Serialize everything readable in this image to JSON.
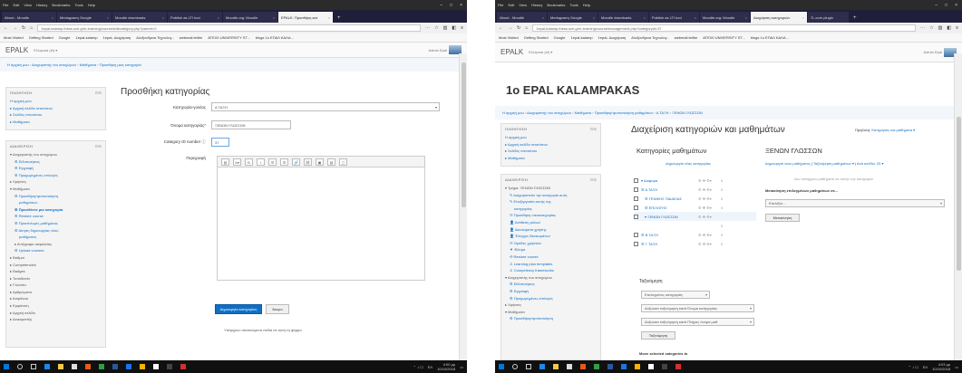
{
  "browser": {
    "menu": [
      "File",
      "Edit",
      "View",
      "History",
      "Bookmarks",
      "Tools",
      "Help"
    ],
    "window_controls": [
      "–",
      "□",
      "×"
    ],
    "bookmarks": [
      "Most Visited",
      "Getting Started",
      "Google",
      "1epal-kalamp",
      "1epal- Διαχείριση",
      "Αλεξανδρεια Τεχνολογ..",
      "webmail.teithe",
      "ATEIXI UNIVERSITY ST...",
      "blogs 1o ΕΠΑΛ ΚΑΛΑ..."
    ],
    "tab_plus": "+"
  },
  "shotA": {
    "tabs": [
      "About - Moodle",
      "Μετάφραση Google",
      "Moodle downloads",
      "Publish as LTI tool",
      "Moodle.org: Moodle",
      "EPALK: Προσθήκη κατ"
    ],
    "url": "1epal-kalamp.thess.sch.gr/e-learning/course/editcategory.php?parent=0",
    "site_brand": "EPALK",
    "lang": "Ελληνικά (el) ▾",
    "user": "Admin Epal",
    "breadcrumb": [
      "Η αρχική μου",
      "Διαχειριστής του ιστοχώρου",
      "Μαθήματα",
      "Προσθήκη μιας κατηγορία"
    ],
    "nav_block": {
      "title": "ΠΛΟΗΓΗΣΗ",
      "items": [
        "Η αρχική μου",
        "▸ Αρχική σελίδα ιστοτόπου",
        "▸ Σελίδες ιστοτόπου",
        "▸ Μαθήματα"
      ]
    },
    "admin_block": {
      "title": "ΔΙΑΧΕΙΡΙΣΗ",
      "items": [
        "▾ Διαχειριστής του ιστοχώρου",
        "⚙ Ειδοποιήσεις",
        "⚙ Εγγραφή",
        "⚙ Προχωρημένες επιλογές",
        "▸ Χρήστες",
        "▾ Μαθήματα",
        "⚙ Προσθήκη/τροποποίηση",
        "μαθημάτων",
        "⚙ Προσθέστε μια κατηγορία",
        "⚙ Restore course",
        "⚙ Προεπιλογές μαθήματος",
        "⚙ Αίτηση δημιουργίας νέου",
        "μαθήματος",
        "▸ Αντίγραφα ασφαλείας",
        "⚙ Upload courses",
        "▸ Βαθμοί",
        "▸ Competencies",
        "▸ Badges",
        "▸ Τοποθεσία",
        "▸ Γλώσσα",
        "▸ Αρθρώματα",
        "▸ Ασφάλεια",
        "▸ Εμφάνιση",
        "▸ Αρχική σελίδα",
        "▸ Διακομιστής"
      ]
    },
    "page_title": "Προσθήκη κατηγορίας",
    "form": {
      "parent_label": "Κατηγορία-γονέας",
      "parent_value": "Α ΤΑΞΗ",
      "name_label": "Όνομα κατηγορίας",
      "name_value": "ΞΕΝΩΝ ΓΛΩΣΣΩΝ",
      "idnumber_label": "Category ID number",
      "idnumber_value": "37",
      "desc_label": "Περιγραφή",
      "create_button": "Δημιουργία κατηγορίας",
      "cancel_button": "Άκυρο",
      "required_note": "Υπάρχουν απαιτούμενα πεδία σε αυτή τη φόρμα"
    },
    "editor_tools": [
      "▤",
      "A▾",
      "B",
      "I",
      "☰",
      "☰",
      "🔗",
      "⛓",
      "▣",
      "▤",
      "▢"
    ],
    "tray": {
      "time": "4:00 μμ",
      "date": "10/10/2018",
      "lang": "ΕΛ"
    }
  },
  "shotB": {
    "tabs": [
      "About - Moodle",
      "Μετάφραση Google",
      "Moodle downloads",
      "Publish as LTI tool",
      "Moodle.org: Moodle",
      "Διαχείριση κατηγοριών",
      "7L.com plugin"
    ],
    "url": "1epal-kalamp.thess.sch.gr/e-learning/course/management.php?categoryid=37",
    "site_brand": "EPALK",
    "lang": "Ελληνικά (el) ▾",
    "user": "Admin Epal",
    "site_heading": "1o EPAL KALAMPAKAS",
    "breadcrumb": [
      "Η αρχική μου",
      "Διαχειριστής του ιστοχώρου",
      "Μαθήματα",
      "Προσθήκη/τροποποίηση μαθημάτων",
      "Α ΤΑΞΗ",
      "ΞΕΝΩΝ ΓΛΩΣΣΩΝ"
    ],
    "nav_block": {
      "title": "ΠΛΟΗΓΗΣΗ",
      "items": [
        "Η αρχική μου",
        "▸ Αρχική σελίδα ιστοτόπου",
        "▸ Σελίδες ιστοτόπου",
        "▸ Μαθήματα"
      ]
    },
    "admin_block": {
      "title": "ΔΙΑΧΕΙΡΙΣΗ",
      "items": [
        "▾ Τμήμα: ΞΕΝΩΝ ΓΛΩΣΣΩΝ",
        "✎ Διαχειριστείτε την κατηγορία αυτή",
        "✎ Επεξεργασία αυτής της",
        "κατηγορίας",
        "☷ Προσθήκη υποκατηγορίας",
        "👤 Ανάθεση ρόλων",
        "👤 Δικαιώματα χρήσης",
        "👤 Έλεγχος δικαιωμάτων",
        "☷ Ομάδες χρηστών",
        "▼ Φίλτρα",
        "⟲ Restore course",
        "♙ Learning plan templates",
        "♙ Competency frameworks",
        "▾ Διαχειριστής του ιστοχώρου",
        "⚙ Ειδοποιήσεις",
        "⚙ Εγγραφή",
        "⚙ Προχωρημένες επιλογές",
        "▸ Χρήστες",
        "▾ Μαθήματα",
        "⚙ Προσθήκη/τροποποίηση"
      ]
    },
    "page_title": "Διαχείριση κατηγοριών και μαθημάτων",
    "view_label": "Προβολή:",
    "view_value": "Κατηγορίες και μαθήματα ▾",
    "cat_heading": "Κατηγορίες μαθημάτων",
    "cat_create": "Δημιουργία νέας κατηγορίας",
    "categories": [
      {
        "name": "▾ Διάφορα",
        "count": "0"
      },
      {
        "name": "☰ Α ΤΑΞΗ",
        "count": "0"
      },
      {
        "name": "☰ ΓΕΝΙΚΗΣ ΠΑΙΔΕΙΑΣ",
        "count": "0"
      },
      {
        "name": "☰ ΕΠΙΛΟΓΗΣ",
        "count": "0"
      },
      {
        "name": "▾ ΞΕΝΩΝ ΓΛΩΣΣΩΝ",
        "count": ""
      },
      {
        "name": "",
        "count": "0"
      },
      {
        "name": "☰ Β ΤΑΞΗ",
        "count": "0"
      },
      {
        "name": "☰ Γ ΤΑΞΗ",
        "count": "0"
      }
    ],
    "cat_controls": "⚙ ✥ ⚙▾",
    "sort_label": "Ταξινόμηση",
    "sort_select": "Επιλεγμένες κατηγορίες",
    "sort_name": "Αύξουσα ταξινόμηση κατά Όνομα κατηγορίας",
    "sort_idnumber": "Αύξουσα ταξινόμηση κατά Πλήρες όνομα μαθ",
    "sort_button": "Ταξινόμηση",
    "move_label": "Move selected categories to",
    "course_heading": "ΞΕΝΩΝ ΓΛΩΣΣΩΝ",
    "course_links": [
      "Δημιουργία νέου μαθήματος",
      "Ταξινόμηση μαθημάτων ▾",
      "Ανά σελίδα: 20 ▾"
    ],
    "no_courses": "Δεν υπάρχουν μαθήματα σε αυτήν την κατηγορία",
    "move_courses_label": "Μετακίνηση επιλεγμένων μαθημάτων σε...",
    "move_select": "Επιλέξτε...",
    "move_button": "Μετακίνηση",
    "tray": {
      "time": "4:03 μμ",
      "date": "10/10/2018",
      "lang": "ΕΛ"
    }
  },
  "colors": {
    "accent": "#0f6fc5",
    "taskbar": "#101010",
    "tabbar": "#1f1f3a"
  }
}
